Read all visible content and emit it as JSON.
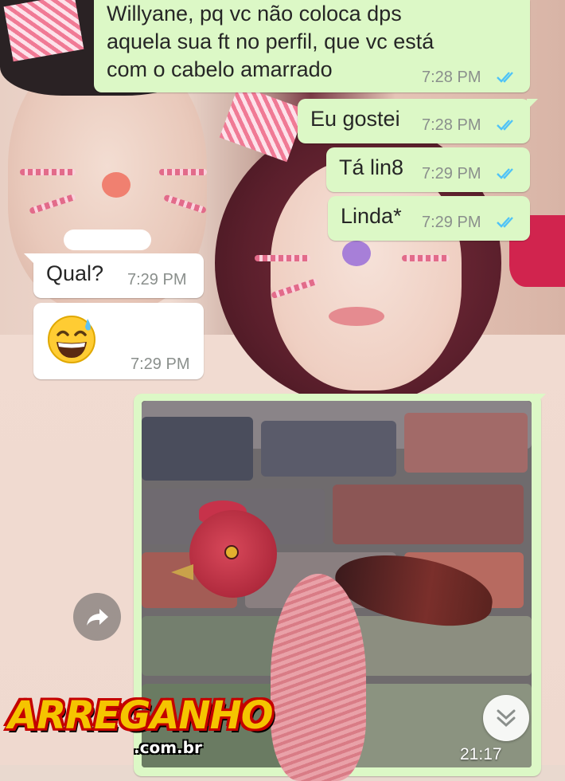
{
  "messages": [
    {
      "direction": "outgoing",
      "lines": [
        "Willyane, pq vc não coloca dps",
        "aquela sua ft no perfil, que vc está",
        "com o cabelo amarrado"
      ],
      "time": "7:28 PM",
      "status": "read"
    },
    {
      "direction": "outgoing",
      "text": "Eu gostei",
      "time": "7:28 PM",
      "status": "read"
    },
    {
      "direction": "outgoing",
      "text": "Tá lin8",
      "time": "7:29 PM",
      "status": "read"
    },
    {
      "direction": "outgoing",
      "text": "Linda*",
      "time": "7:29 PM",
      "status": "read"
    },
    {
      "direction": "incoming",
      "text": "Qual?",
      "time": "7:29 PM"
    },
    {
      "direction": "incoming",
      "emoji": "😅",
      "time": "7:29 PM"
    },
    {
      "direction": "outgoing",
      "type": "image",
      "image_subject": "rooster",
      "time": "21:17"
    }
  ],
  "controls": {
    "forward_icon": "share-forward-icon",
    "scroll_icon": "double-chevron-down-icon"
  },
  "watermark": {
    "name": "ARREGANHO",
    "domain": ".com.br"
  },
  "colors": {
    "outgoing_bubble": "#dcf8c6",
    "incoming_bubble": "#ffffff",
    "read_ticks": "#4fc3f7",
    "time_text": "#8a8f8c"
  }
}
